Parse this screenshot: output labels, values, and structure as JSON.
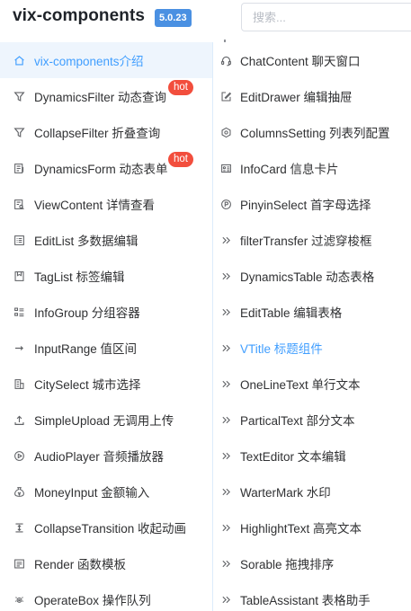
{
  "header": {
    "brand": "vix-components",
    "version": "5.0.23",
    "search_placeholder": "搜索..."
  },
  "sidebar": {
    "items": [
      {
        "label": "vix-components介绍",
        "icon": "home-icon",
        "active": true
      },
      {
        "label": "DynamicsFilter 动态查询",
        "icon": "filter-icon",
        "badge": "hot"
      },
      {
        "label": "CollapseFilter 折叠查询",
        "icon": "filter-icon"
      },
      {
        "label": "DynamicsForm 动态表单",
        "icon": "form-icon",
        "badge": "hot"
      },
      {
        "label": "ViewContent 详情查看",
        "icon": "document-view-icon"
      },
      {
        "label": "EditList 多数据编辑",
        "icon": "list-edit-icon"
      },
      {
        "label": "TagList 标签编辑",
        "icon": "tag-icon"
      },
      {
        "label": "InfoGroup 分组容器",
        "icon": "group-icon"
      },
      {
        "label": "InputRange 值区间",
        "icon": "range-icon"
      },
      {
        "label": "CitySelect 城市选择",
        "icon": "city-icon"
      },
      {
        "label": "SimpleUpload 无调用上传",
        "icon": "upload-icon"
      },
      {
        "label": "AudioPlayer 音频播放器",
        "icon": "play-icon"
      },
      {
        "label": "MoneyInput 金额输入",
        "icon": "money-icon"
      },
      {
        "label": "CollapseTransition 收起动画",
        "icon": "collapse-icon"
      },
      {
        "label": "Render 函数模板",
        "icon": "render-icon"
      },
      {
        "label": "OperateBox 操作队列",
        "icon": "operate-icon"
      }
    ]
  },
  "dropdown": {
    "items": [
      {
        "label": "ChatContent 聊天窗口",
        "icon": "headset-icon"
      },
      {
        "label": "EditDrawer 编辑抽屉",
        "icon": "edit-icon"
      },
      {
        "label": "ColumnsSetting 列表列配置",
        "icon": "settings-icon"
      },
      {
        "label": "InfoCard 信息卡片",
        "icon": "card-icon"
      },
      {
        "label": "PinyinSelect 首字母选择",
        "icon": "pinyin-icon"
      },
      {
        "label": "filterTransfer 过滤穿梭框",
        "icon": "double-chevron-icon"
      },
      {
        "label": "DynamicsTable 动态表格",
        "icon": "double-chevron-icon"
      },
      {
        "label": "EditTable 编辑表格",
        "icon": "double-chevron-icon"
      },
      {
        "label": "VTitle 标题组件",
        "icon": "double-chevron-icon",
        "highlight": true
      },
      {
        "label": "OneLineText 单行文本",
        "icon": "double-chevron-icon"
      },
      {
        "label": "ParticalText 部分文本",
        "icon": "double-chevron-icon"
      },
      {
        "label": "TextEditor 文本编辑",
        "icon": "double-chevron-icon"
      },
      {
        "label": "WarterMark 水印",
        "icon": "double-chevron-icon"
      },
      {
        "label": "HighlightText 高亮文本",
        "icon": "double-chevron-icon"
      },
      {
        "label": "Sorable 拖拽排序",
        "icon": "double-chevron-icon"
      },
      {
        "label": "TableAssistant 表格助手",
        "icon": "double-chevron-icon"
      }
    ]
  },
  "colors": {
    "accent": "#409eff",
    "hot_badge": "#f24e3d",
    "version_badge": "#4a90e2",
    "active_bg": "#eef5fd"
  }
}
